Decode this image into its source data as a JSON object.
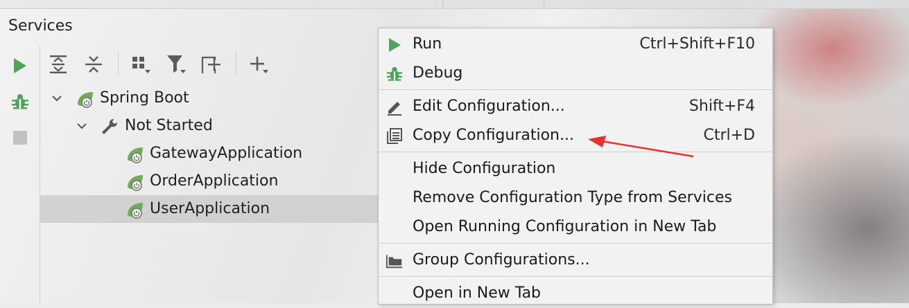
{
  "panel": {
    "title": "Services"
  },
  "left_toolbar": [
    {
      "name": "run-icon",
      "color": "#4fa35a"
    },
    {
      "name": "debug-icon",
      "color": "#4fa35a"
    },
    {
      "name": "stop-icon",
      "color": "#c0c0c0"
    }
  ],
  "top_toolbar": [
    "expand-all-icon",
    "collapse-all-icon",
    "group-by-icon",
    "filter-icon",
    "new-tab-icon",
    "add-service-icon"
  ],
  "tree": {
    "root": {
      "label": "Spring Boot",
      "expanded": true
    },
    "group": {
      "label": "Not Started",
      "expanded": true
    },
    "apps": [
      {
        "label": "GatewayApplication",
        "selected": false
      },
      {
        "label": "OrderApplication",
        "selected": false
      },
      {
        "label": "UserApplication",
        "selected": true
      }
    ]
  },
  "context_menu": {
    "items": [
      {
        "label": "Run",
        "shortcut": "Ctrl+Shift+F10",
        "icon": "run-icon"
      },
      {
        "label": "Debug",
        "shortcut": "",
        "icon": "debug-icon"
      },
      {
        "label": "Edit Configuration...",
        "shortcut": "Shift+F4",
        "icon": "pencil-icon"
      },
      {
        "label": "Copy Configuration...",
        "shortcut": "Ctrl+D",
        "icon": "copy-icon"
      },
      {
        "label": "Hide Configuration",
        "shortcut": "",
        "icon": ""
      },
      {
        "label": "Remove Configuration Type from Services",
        "shortcut": "",
        "icon": ""
      },
      {
        "label": "Open Running Configuration in New Tab",
        "shortcut": "",
        "icon": ""
      },
      {
        "label": "Group Configurations...",
        "shortcut": "",
        "icon": "folder-icon"
      },
      {
        "label": "Open in New Tab",
        "shortcut": "",
        "icon": ""
      }
    ]
  },
  "colors": {
    "accent_green": "#4fa35a",
    "annotation_arrow": "#e8322e",
    "menu_background": "#f2f2f2",
    "selection": "#cdcdcd"
  }
}
